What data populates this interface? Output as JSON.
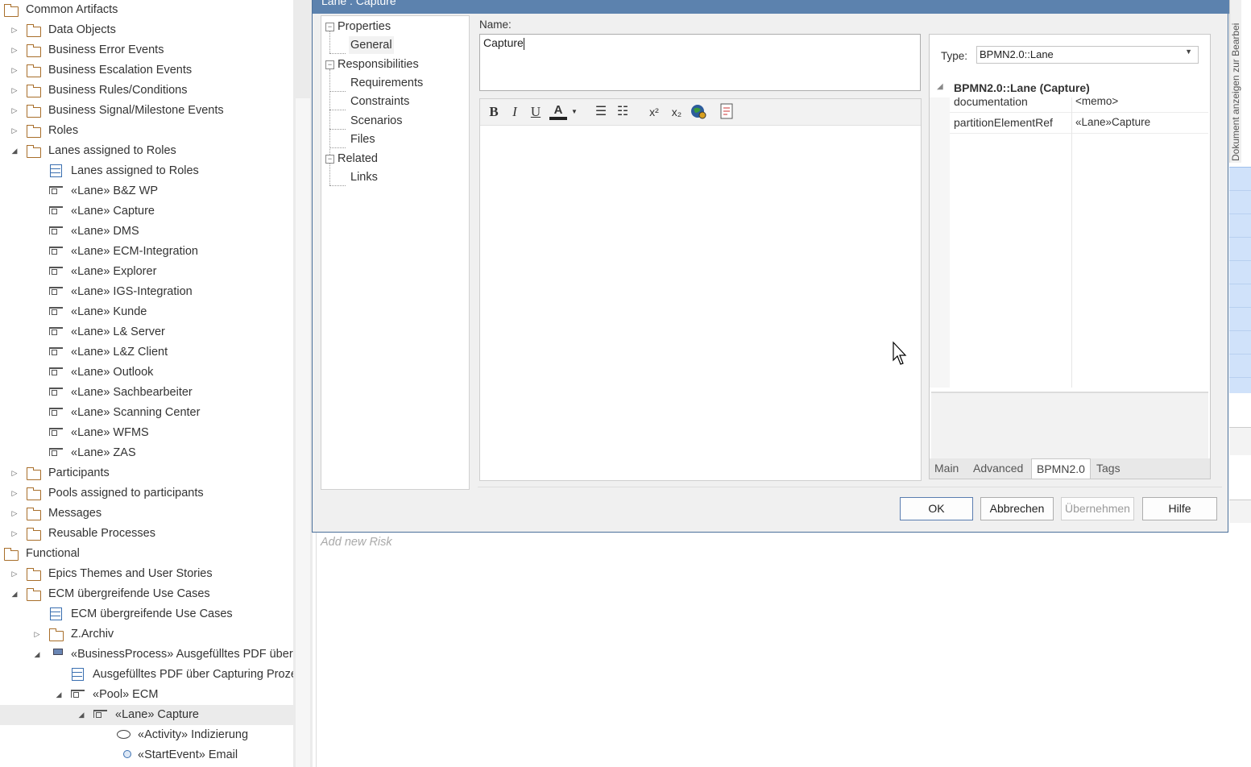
{
  "browser": {
    "items": [
      {
        "label": "Common Artifacts",
        "icon": "folder-icon",
        "expander": "",
        "level": 0
      },
      {
        "label": "Data Objects",
        "icon": "folder-icon",
        "expander": "▷",
        "level": 1
      },
      {
        "label": "Business Error Events",
        "icon": "folder-icon",
        "expander": "▷",
        "level": 1
      },
      {
        "label": "Business Escalation Events",
        "icon": "folder-icon",
        "expander": "▷",
        "level": 1
      },
      {
        "label": "Business Rules/Conditions",
        "icon": "folder-icon",
        "expander": "▷",
        "level": 1
      },
      {
        "label": "Business Signal/Milestone Events",
        "icon": "folder-icon",
        "expander": "▷",
        "level": 1
      },
      {
        "label": "Roles",
        "icon": "folder-icon",
        "expander": "▷",
        "level": 1
      },
      {
        "label": "Lanes assigned to Roles",
        "icon": "folder-icon",
        "expander": "◢",
        "level": 1
      },
      {
        "label": "Lanes assigned to Roles",
        "icon": "diagram-icon",
        "expander": "",
        "level": 2
      },
      {
        "label": "«Lane» B&Z WP",
        "icon": "lane-icon",
        "expander": "",
        "level": 2
      },
      {
        "label": "«Lane» Capture",
        "icon": "lane-icon",
        "expander": "",
        "level": 2
      },
      {
        "label": "«Lane» DMS",
        "icon": "lane-icon",
        "expander": "",
        "level": 2
      },
      {
        "label": "«Lane» ECM-Integration",
        "icon": "lane-icon",
        "expander": "",
        "level": 2
      },
      {
        "label": "«Lane» Explorer",
        "icon": "lane-icon",
        "expander": "",
        "level": 2
      },
      {
        "label": "«Lane» IGS-Integration",
        "icon": "lane-icon",
        "expander": "",
        "level": 2
      },
      {
        "label": "«Lane» Kunde",
        "icon": "lane-icon",
        "expander": "",
        "level": 2
      },
      {
        "label": "«Lane» L& Server",
        "icon": "lane-icon",
        "expander": "",
        "level": 2
      },
      {
        "label": "«Lane» L&Z Client",
        "icon": "lane-icon",
        "expander": "",
        "level": 2
      },
      {
        "label": "«Lane» Outlook",
        "icon": "lane-icon",
        "expander": "",
        "level": 2
      },
      {
        "label": "«Lane» Sachbearbeiter",
        "icon": "lane-icon",
        "expander": "",
        "level": 2
      },
      {
        "label": "«Lane» Scanning Center",
        "icon": "lane-icon",
        "expander": "",
        "level": 2
      },
      {
        "label": "«Lane» WFMS",
        "icon": "lane-icon",
        "expander": "",
        "level": 2
      },
      {
        "label": "«Lane» ZAS",
        "icon": "lane-icon",
        "expander": "",
        "level": 2
      },
      {
        "label": "Participants",
        "icon": "folder-icon",
        "expander": "▷",
        "level": 1
      },
      {
        "label": "Pools assigned to participants",
        "icon": "folder-icon",
        "expander": "▷",
        "level": 1
      },
      {
        "label": "Messages",
        "icon": "folder-icon",
        "expander": "▷",
        "level": 1
      },
      {
        "label": "Reusable Processes",
        "icon": "folder-icon",
        "expander": "▷",
        "level": 1
      },
      {
        "label": "Functional",
        "icon": "folder-icon",
        "expander": "",
        "level": 0
      },
      {
        "label": "Epics Themes and User Stories",
        "icon": "folder-icon",
        "expander": "▷",
        "level": 1
      },
      {
        "label": "ECM übergreifende Use Cases",
        "icon": "folder-icon",
        "expander": "◢",
        "level": 1
      },
      {
        "label": "ECM übergreifende Use Cases",
        "icon": "diagram-icon",
        "expander": "",
        "level": 2
      },
      {
        "label": "Z.Archiv",
        "icon": "folder-icon",
        "expander": "▷",
        "level": 2
      },
      {
        "label": "«BusinessProcess» Ausgefülltes PDF über Capturing Prozess",
        "icon": "business-process-icon",
        "expander": "◢",
        "level": 2
      },
      {
        "label": "Ausgefülltes PDF über Capturing Prozess",
        "icon": "diagram-icon",
        "expander": "",
        "level": 3
      },
      {
        "label": "«Pool» ECM",
        "icon": "lane-icon",
        "expander": "◢",
        "level": 3
      },
      {
        "label": "«Lane» Capture",
        "icon": "lane-icon",
        "expander": "◢",
        "level": 4,
        "selected": true
      },
      {
        "label": "«Activity» Indizierung",
        "icon": "activity-icon",
        "expander": "",
        "level": 5
      },
      {
        "label": "«StartEvent» Email",
        "icon": "start-event-icon",
        "expander": "",
        "level": 5
      }
    ]
  },
  "risk": {
    "placeholder": "Add new Risk"
  },
  "side_tab": {
    "label": "Dokument anzeigen zur Bearbei"
  },
  "dialog": {
    "title": "Lane : Capture",
    "nav": {
      "properties": "Properties",
      "general": "General",
      "responsibilities": "Responsibilities",
      "requirements": "Requirements",
      "constraints": "Constraints",
      "scenarios": "Scenarios",
      "files": "Files",
      "related": "Related",
      "links": "Links"
    },
    "name_label": "Name:",
    "name_value": "Capture",
    "toolbar": {
      "bold": "B",
      "italic": "I",
      "underline": "U",
      "highlight": "A",
      "bullets": "☰",
      "numbered": "☷",
      "superscript": "x²",
      "subscript": "x₂"
    },
    "type_label": "Type:",
    "type_value": "BPMN2.0::Lane",
    "grid": {
      "header": "BPMN2.0::Lane (Capture)",
      "rows": [
        {
          "key": "documentation",
          "value": "<memo>"
        },
        {
          "key": "partitionElementRef",
          "value": "«Lane»Capture"
        }
      ]
    },
    "tabs": [
      "Main",
      "Advanced",
      "BPMN2.0",
      "Tags"
    ],
    "active_tab": "BPMN2.0",
    "buttons": {
      "ok": "OK",
      "cancel": "Abbrechen",
      "apply": "Übernehmen",
      "help": "Hilfe"
    }
  }
}
